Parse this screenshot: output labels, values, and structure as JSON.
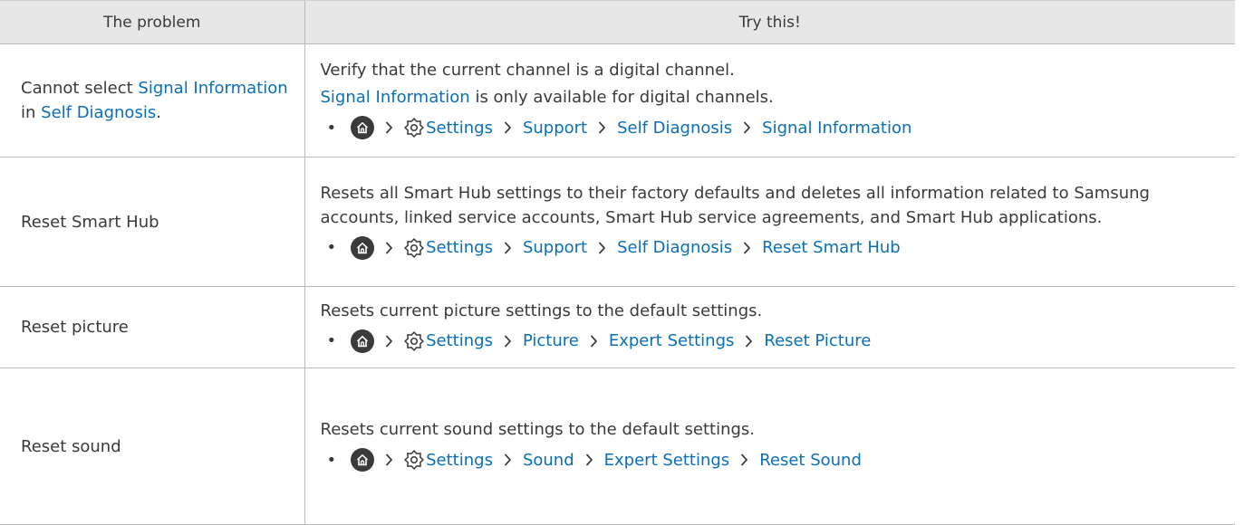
{
  "header": {
    "col_problem": "The problem",
    "col_solution": "Try this!"
  },
  "icons": {
    "home": "home-icon",
    "settings": "settings-gear-icon",
    "separator": "chevron-right-icon"
  },
  "rows": [
    {
      "problem": [
        {
          "text": "Cannot select ",
          "link": false
        },
        {
          "text": "Signal Information",
          "link": true
        },
        {
          "text": " in ",
          "link": false
        },
        {
          "text": "Self Diagnosis",
          "link": true
        },
        {
          "text": ".",
          "link": false
        }
      ],
      "paragraphs": [
        [
          {
            "text": "Verify that the current channel is a digital channel.",
            "link": false
          }
        ],
        [
          {
            "text": "Signal Information",
            "link": true
          },
          {
            "text": " is only available for digital channels.",
            "link": false
          }
        ]
      ],
      "path": [
        "Settings",
        "Support",
        "Self Diagnosis",
        "Signal Information"
      ]
    },
    {
      "problem": [
        {
          "text": "Reset Smart Hub",
          "link": false
        }
      ],
      "paragraphs": [
        [
          {
            "text": "Resets all Smart Hub settings to their factory defaults and deletes all information related to Samsung accounts, linked service accounts, Smart Hub service agreements, and Smart Hub applications.",
            "link": false
          }
        ]
      ],
      "path": [
        "Settings",
        "Support",
        "Self Diagnosis",
        "Reset Smart Hub"
      ]
    },
    {
      "problem": [
        {
          "text": "Reset picture",
          "link": false
        }
      ],
      "paragraphs": [
        [
          {
            "text": "Resets current picture settings to the default settings.",
            "link": false
          }
        ]
      ],
      "path": [
        "Settings",
        "Picture",
        "Expert Settings",
        "Reset Picture"
      ]
    },
    {
      "problem": [
        {
          "text": "Reset sound",
          "link": false
        }
      ],
      "paragraphs": [
        [
          {
            "text": "Resets current sound settings to the default settings.",
            "link": false
          }
        ]
      ],
      "path": [
        "Settings",
        "Sound",
        "Expert Settings",
        "Reset Sound"
      ]
    }
  ]
}
